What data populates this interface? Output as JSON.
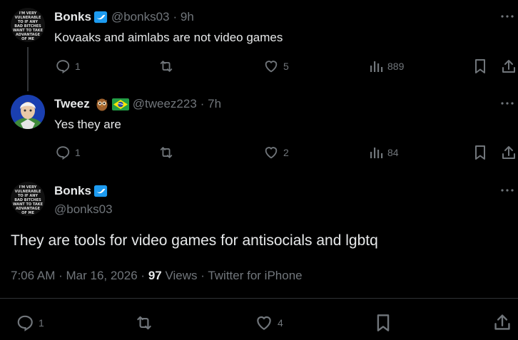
{
  "tweets": [
    {
      "name": "Bonks",
      "handle": "@bonks03",
      "time": "· 9h",
      "text": "Kovaaks and aimlabs are not video games",
      "replies": "1",
      "likes": "5",
      "views": "889"
    },
    {
      "name": "Tweez",
      "handle": "@tweez223",
      "time": "· 7h",
      "text": "Yes they are",
      "replies": "1",
      "likes": "2",
      "views": "84",
      "badges": [
        "owl-emoji",
        "brazil-flag"
      ]
    }
  ],
  "main": {
    "name": "Bonks",
    "handle": "@bonks03",
    "text": "They are tools for video games for antisocials and lgbtq",
    "time": "7:06 AM",
    "date": "Mar 16, 2026",
    "views_count": "97",
    "views_label": "Views",
    "source": "Twitter for iPhone",
    "replies": "1",
    "likes": "4"
  },
  "avatar_text": [
    "I'M VERY",
    "VULNERABLE",
    "TO IF ANY",
    "BAD BITCHES",
    "WANT TO TAKE",
    "ADVANTAGE",
    "OF ME"
  ],
  "colors": {
    "background": "#000000",
    "verified": "#1d9bf0",
    "muted": "#71767b",
    "text": "#e7e9ea"
  }
}
